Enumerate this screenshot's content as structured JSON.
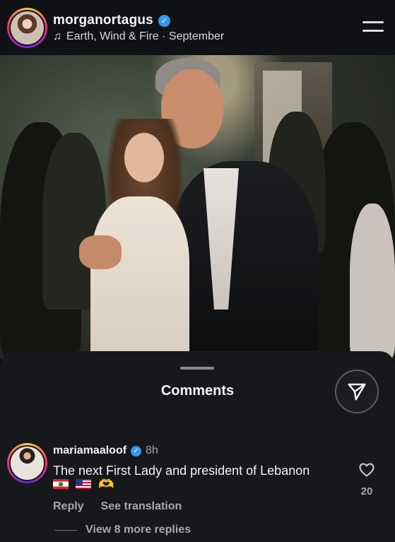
{
  "post": {
    "username": "morganortagus",
    "music": "Earth, Wind & Fire · September"
  },
  "comments_sheet": {
    "title": "Comments",
    "comment": {
      "username": "mariamaaloof",
      "time": "8h",
      "text": "The next First Lady and president of Lebanon",
      "emojis": [
        "flag-lebanon",
        "flag-usa",
        "heart-hands"
      ],
      "likes": "20",
      "reply_label": "Reply",
      "translate_label": "See translation",
      "view_replies_label": "View 8 more replies"
    }
  },
  "colors": {
    "background": "#0c0d10",
    "sheet": "#16181c",
    "verified": "#3897f0",
    "secondary_text": "#a8a8a8"
  }
}
